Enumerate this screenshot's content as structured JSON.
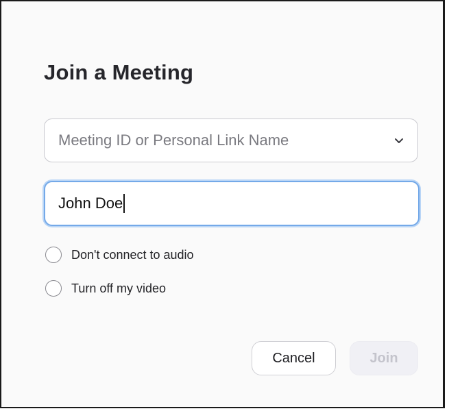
{
  "dialog": {
    "title": "Join a Meeting",
    "meeting_id": {
      "placeholder": "Meeting ID or Personal Link Name",
      "icon": "chevron-down-icon"
    },
    "name": {
      "value": "John Doe"
    },
    "options": [
      {
        "label": "Don't connect to audio",
        "checked": false
      },
      {
        "label": "Turn off my video",
        "checked": false
      }
    ],
    "buttons": {
      "cancel_label": "Cancel",
      "join_label": "Join",
      "join_enabled": false
    },
    "colors": {
      "focus_border": "#74a9e8",
      "title_text": "#26262b",
      "disabled_text": "#c4c4cc"
    }
  }
}
